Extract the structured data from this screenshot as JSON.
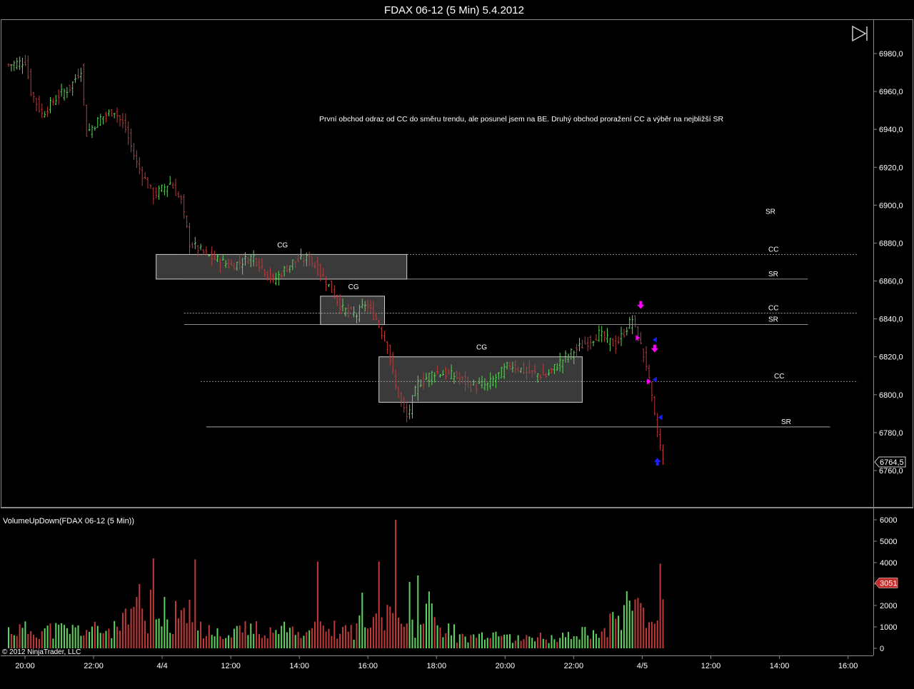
{
  "title": "FDAX 06-12 (5 Min)  5.4.2012",
  "note": "První obchod odraz od CC do směru trendu, ale posunel jsem na BE. Druhý obchod proražení CC a výběr na nejbližší SR",
  "copyright": "© 2012 NinjaTrader, LLC",
  "colors": {
    "up": "#5fd35f",
    "down": "#c03a3a",
    "panel_bg": "#000000",
    "grid": "#ffffff",
    "marker_magenta": "#ff00ff",
    "marker_blue": "#1c1cff",
    "last_price_box": "#c42b2b"
  },
  "chart_data": [
    {
      "type": "candlestick",
      "title": "FDAX 06-12 (5 Min)  5.4.2012",
      "x_ticks": [
        "20:00",
        "22:00",
        "4/4",
        "12:00",
        "14:00",
        "16:00",
        "18:00",
        "20:00",
        "22:00",
        "4/5",
        "12:00",
        "14:00",
        "16:00"
      ],
      "y_ticks": [
        "6980,0",
        "6960,0",
        "6940,0",
        "6920,0",
        "6900,0",
        "6880,0",
        "6860,0",
        "6840,0",
        "6820,0",
        "6800,0",
        "6780,0",
        "6760,0"
      ],
      "ylim": [
        6754,
        6990
      ],
      "last_price": "6764,5",
      "last_price_value": 6764.5,
      "anchors": [
        {
          "i": 0,
          "p": 6974
        },
        {
          "i": 6,
          "p": 6976
        },
        {
          "i": 8,
          "p": 6960
        },
        {
          "i": 12,
          "p": 6948
        },
        {
          "i": 18,
          "p": 6958
        },
        {
          "i": 22,
          "p": 6962
        },
        {
          "i": 26,
          "p": 6972
        },
        {
          "i": 28,
          "p": 6938
        },
        {
          "i": 33,
          "p": 6946
        },
        {
          "i": 38,
          "p": 6950
        },
        {
          "i": 42,
          "p": 6940
        },
        {
          "i": 46,
          "p": 6922
        },
        {
          "i": 52,
          "p": 6905
        },
        {
          "i": 58,
          "p": 6912
        },
        {
          "i": 62,
          "p": 6902
        },
        {
          "i": 65,
          "p": 6880
        },
        {
          "i": 72,
          "p": 6873
        },
        {
          "i": 80,
          "p": 6868
        },
        {
          "i": 88,
          "p": 6873
        },
        {
          "i": 95,
          "p": 6860
        },
        {
          "i": 102,
          "p": 6870
        },
        {
          "i": 108,
          "p": 6872
        },
        {
          "i": 114,
          "p": 6860
        },
        {
          "i": 120,
          "p": 6845
        },
        {
          "i": 125,
          "p": 6842
        },
        {
          "i": 128,
          "p": 6848
        },
        {
          "i": 132,
          "p": 6840
        },
        {
          "i": 136,
          "p": 6826
        },
        {
          "i": 139,
          "p": 6804
        },
        {
          "i": 143,
          "p": 6788
        },
        {
          "i": 147,
          "p": 6806
        },
        {
          "i": 153,
          "p": 6812
        },
        {
          "i": 160,
          "p": 6810
        },
        {
          "i": 166,
          "p": 6805
        },
        {
          "i": 172,
          "p": 6805
        },
        {
          "i": 180,
          "p": 6816
        },
        {
          "i": 186,
          "p": 6812
        },
        {
          "i": 193,
          "p": 6810
        },
        {
          "i": 200,
          "p": 6820
        },
        {
          "i": 206,
          "p": 6826
        },
        {
          "i": 212,
          "p": 6832
        },
        {
          "i": 218,
          "p": 6826
        },
        {
          "i": 224,
          "p": 6840
        },
        {
          "i": 229,
          "p": 6816
        },
        {
          "i": 232,
          "p": 6788
        },
        {
          "i": 235,
          "p": 6765
        }
      ],
      "bar_count": 236,
      "zones": [
        {
          "label": "CG",
          "price_low": 6861,
          "price_high": 6874,
          "bar_from": 53,
          "bar_to": 143
        },
        {
          "label": "CG",
          "price_low": 6837,
          "price_high": 6852,
          "bar_from": 112,
          "bar_to": 135
        },
        {
          "label": "CG",
          "price_low": 6796,
          "price_high": 6820,
          "bar_from": 133,
          "bar_to": 206
        }
      ],
      "levels": [
        {
          "label": "SR",
          "price": 6861,
          "style": "solid",
          "bar_from": 63,
          "bar_to": 287
        },
        {
          "label": "CC",
          "price": 6874,
          "style": "dashed",
          "bar_from": 60,
          "bar_to": 305
        },
        {
          "label": "CC",
          "price": 6843,
          "style": "dashed",
          "bar_from": 63,
          "bar_to": 305
        },
        {
          "label": "SR",
          "price": 6837,
          "style": "solid",
          "bar_from": 63,
          "bar_to": 287
        },
        {
          "label": "CC",
          "price": 6807,
          "style": "dashed",
          "bar_from": 69,
          "bar_to": 305
        },
        {
          "label": "SR",
          "price": 6783,
          "style": "solid",
          "bar_from": 71,
          "bar_to": 295
        }
      ],
      "extra_labels": [
        {
          "label": "SR",
          "price": 6897
        }
      ],
      "markers": [
        {
          "type": "arrow-down",
          "color": "magenta",
          "bar": 227,
          "price": 6846
        },
        {
          "type": "triangle-right",
          "color": "magenta",
          "bar": 226,
          "price": 6830
        },
        {
          "type": "arrow-down",
          "color": "magenta",
          "bar": 232,
          "price": 6823
        },
        {
          "type": "triangle-left",
          "color": "blue",
          "bar": 232,
          "price": 6829
        },
        {
          "type": "triangle-right",
          "color": "magenta",
          "bar": 230,
          "price": 6807
        },
        {
          "type": "triangle-left",
          "color": "blue",
          "bar": 232,
          "price": 6808
        },
        {
          "type": "triangle-left",
          "color": "blue",
          "bar": 234,
          "price": 6788
        },
        {
          "type": "arrow-up",
          "color": "blue",
          "bar": 233,
          "price": 6766
        }
      ]
    },
    {
      "type": "bar",
      "title": "VolumeUpDown(FDAX 06-12 (5 Min))",
      "y_ticks": [
        "6000",
        "5000",
        "4000",
        "3000",
        "2000",
        "1000",
        "0"
      ],
      "ylim": [
        0,
        6000
      ],
      "last_value": "3051",
      "peaks": [
        {
          "bar": 52,
          "v": 4200
        },
        {
          "bar": 67,
          "v": 4150
        },
        {
          "bar": 111,
          "v": 4050
        },
        {
          "bar": 139,
          "v": 6000
        },
        {
          "bar": 133,
          "v": 4050
        },
        {
          "bar": 147,
          "v": 3400
        },
        {
          "bar": 144,
          "v": 3100
        },
        {
          "bar": 47,
          "v": 3000
        },
        {
          "bar": 234,
          "v": 3950
        }
      ]
    }
  ]
}
